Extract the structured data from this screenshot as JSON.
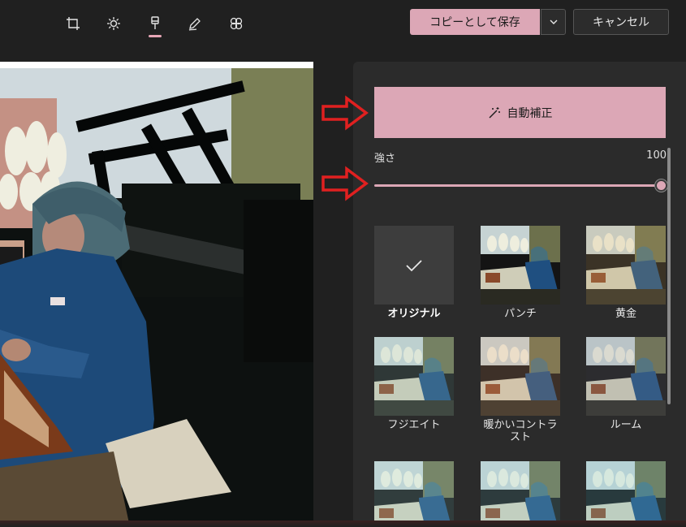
{
  "toolbar": {
    "tools": [
      {
        "name": "crop-tool",
        "icon": "crop-icon"
      },
      {
        "name": "adjust-tool",
        "icon": "brightness-icon"
      },
      {
        "name": "filter-tool",
        "icon": "filter-brush-icon",
        "active": true
      },
      {
        "name": "markup-tool",
        "icon": "pen-icon"
      },
      {
        "name": "retouch-tool",
        "icon": "retouch-icon"
      }
    ],
    "save_label": "コピーとして保存",
    "cancel_label": "キャンセル"
  },
  "panel": {
    "auto_fix_label": "自動補正",
    "strength_label": "強さ",
    "strength_value": "100",
    "strength_fraction": 1.0,
    "filters": [
      {
        "label": "オリジナル",
        "selected": true
      },
      {
        "label": "パンチ"
      },
      {
        "label": "黄金"
      },
      {
        "label": "フジエイト"
      },
      {
        "label": "暖かいコントラスト"
      },
      {
        "label": "ルーム"
      },
      {
        "label": ""
      },
      {
        "label": ""
      },
      {
        "label": ""
      }
    ]
  },
  "colors": {
    "accent": "#dca7b6",
    "background": "#202020",
    "panel": "#2b2b2b",
    "annotation_arrow": "#e02020"
  }
}
